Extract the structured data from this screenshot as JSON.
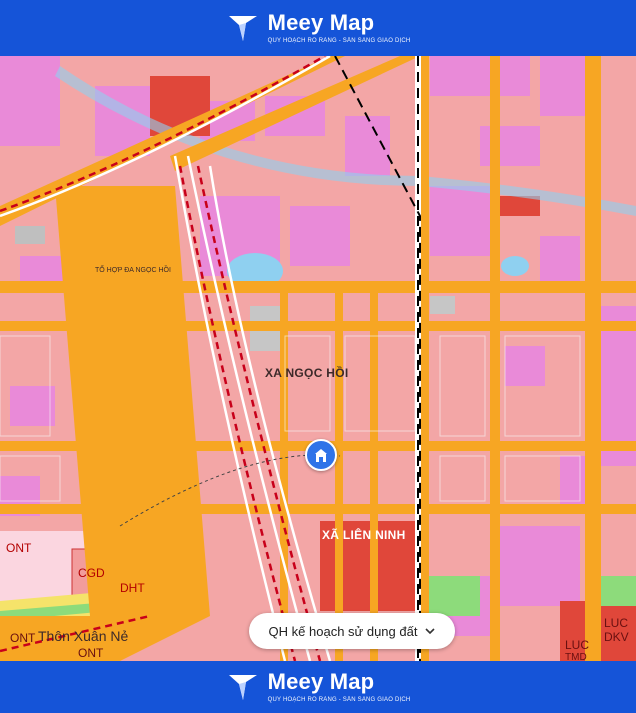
{
  "header": {
    "brand_name": "Meey Map",
    "tagline": "QUY HOẠCH RÕ RÀNG - SẴN SÀNG GIAO DỊCH",
    "logo_icon": "meey-map-logo-icon"
  },
  "footer": {
    "brand_name": "Meey Map",
    "tagline": "QUY HOẠCH RÕ RÀNG - SẴN SÀNG GIAO DỊCH",
    "logo_icon": "meey-map-logo-icon"
  },
  "map": {
    "area_labels": {
      "xa_ngoc_hoi": "XA NGỌC HỒI",
      "xa_lien_ninh": "XÃ LIÊN NINH",
      "to_hop": "TỔ HỢP ĐA NGỌC HỒI",
      "thon_xuan_ne": "Thôn Xuân Nẻ"
    },
    "zone_codes": {
      "ont1": "ONT",
      "cgd": "CGD",
      "dht": "DHT",
      "ont2": "ONT",
      "ont3": "ONT",
      "luc": "LUC",
      "dkv": "DKV",
      "tmd": "TMD",
      "luc2": "LUC"
    },
    "marker_icon": "building-location-pin-icon"
  },
  "layer_selector": {
    "label": "QH kế hoạch sử dụng đất",
    "icon": "chevron-down-icon"
  },
  "colors": {
    "brand_blue": "#1554d8",
    "residential_pink": "#f3a6a6",
    "road_orange": "#f7a623",
    "mixed_use_magenta": "#e98ad8",
    "public_red": "#e0473a",
    "green_park": "#8ddb7b",
    "water_blue": "#8fd0f0"
  }
}
